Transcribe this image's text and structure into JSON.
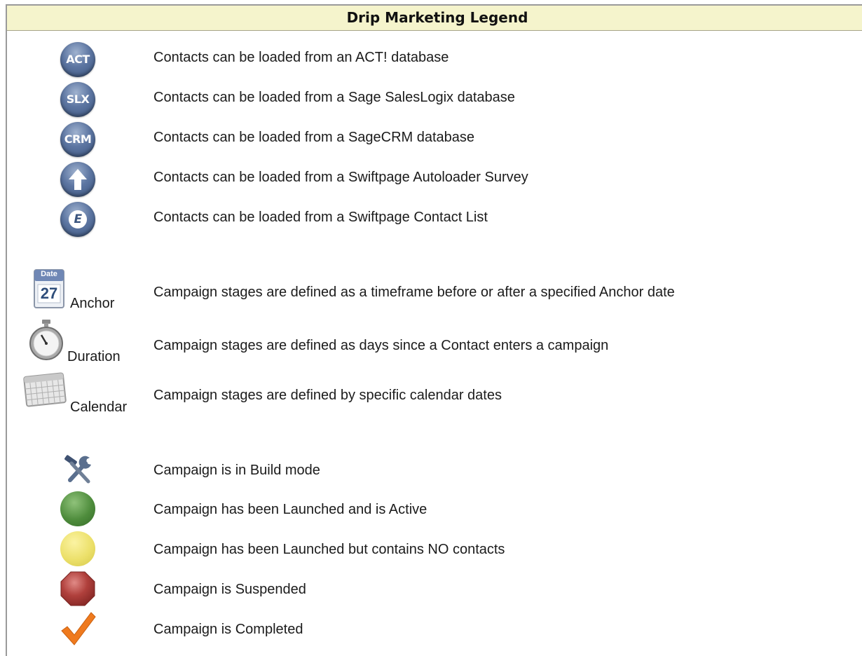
{
  "title": "Drip Marketing Legend",
  "sources": [
    {
      "icon": "act-badge-icon",
      "glyph": "ACT",
      "text": "Contacts can be loaded from an ACT! database"
    },
    {
      "icon": "slx-badge-icon",
      "glyph": "SLX",
      "text": "Contacts can be loaded from a Sage SalesLogix database"
    },
    {
      "icon": "crm-badge-icon",
      "glyph": "CRM",
      "text": "Contacts can be loaded from a SageCRM database"
    },
    {
      "icon": "upload-arrow-icon",
      "glyph": "",
      "text": "Contacts can be loaded from a Swiftpage Autoloader Survey"
    },
    {
      "icon": "e-badge-icon",
      "glyph": "E",
      "text": "Contacts can be loaded from a Swiftpage Contact List"
    }
  ],
  "stages": [
    {
      "icon": "anchor-date-icon",
      "label": "Anchor",
      "date_word": "Date",
      "date_num": "27",
      "text": "Campaign stages are defined as a timeframe before or after a specified Anchor date"
    },
    {
      "icon": "stopwatch-icon",
      "label": "Duration",
      "text": "Campaign stages are defined as days since a Contact enters a campaign"
    },
    {
      "icon": "calendar-icon",
      "label": "Calendar",
      "text": "Campaign stages are defined by specific calendar dates"
    }
  ],
  "statuses": [
    {
      "icon": "tools-icon",
      "text": "Campaign is in Build mode"
    },
    {
      "icon": "green-dot-icon",
      "text": "Campaign has been Launched and is Active"
    },
    {
      "icon": "yellow-dot-icon",
      "text": "Campaign has been Launched but contains NO contacts"
    },
    {
      "icon": "stop-octagon-icon",
      "text": "Campaign is Suspended"
    },
    {
      "icon": "checkmark-icon",
      "text": "Campaign is Completed"
    }
  ],
  "colors": {
    "header_bg": "#f5f4cc",
    "badge_blue": "#5d76a2",
    "active_green": "#4e8c3c",
    "empty_yellow": "#ece06a",
    "suspended_red": "#b0403c",
    "completed_orange": "#ef7a1e"
  }
}
